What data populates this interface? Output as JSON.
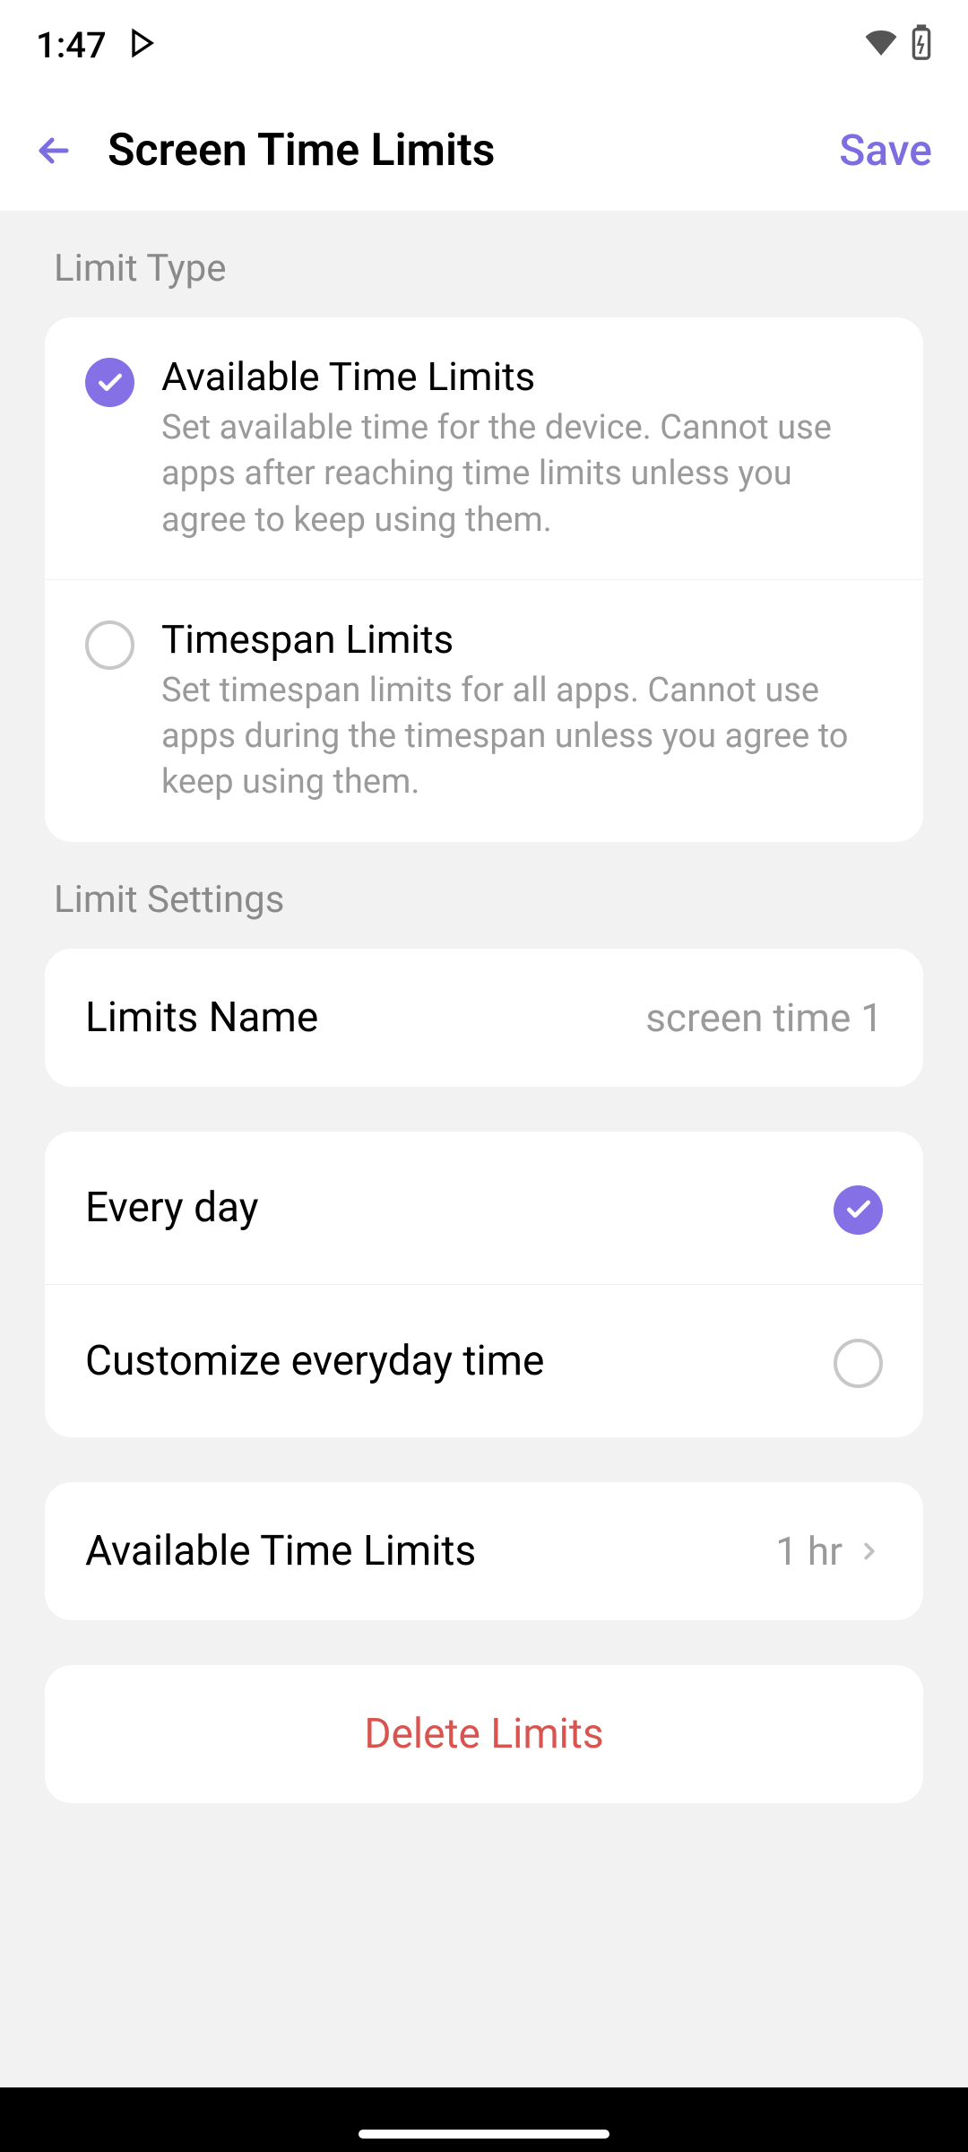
{
  "statusBar": {
    "time": "1:47"
  },
  "header": {
    "title": "Screen Time Limits",
    "saveLabel": "Save"
  },
  "sections": {
    "limitType": "Limit Type",
    "limitSettings": "Limit Settings"
  },
  "limitTypes": {
    "available": {
      "title": "Available Time Limits",
      "description": "Set available time for the device. Cannot use apps after reaching time limits unless you agree to keep using them.",
      "selected": true
    },
    "timespan": {
      "title": "Timespan Limits",
      "description": "Set timespan limits for all apps. Cannot use apps during the timespan unless you agree to keep using them.",
      "selected": false
    }
  },
  "limitsName": {
    "label": "Limits Name",
    "value": "screen time 1"
  },
  "schedule": {
    "everyDay": {
      "label": "Every day",
      "selected": true
    },
    "customize": {
      "label": "Customize everyday time",
      "selected": false
    }
  },
  "availableTime": {
    "label": "Available Time Limits",
    "value": "1 hr"
  },
  "deleteLabel": "Delete Limits",
  "colors": {
    "accent": "#8670e5",
    "danger": "#d9534f"
  }
}
